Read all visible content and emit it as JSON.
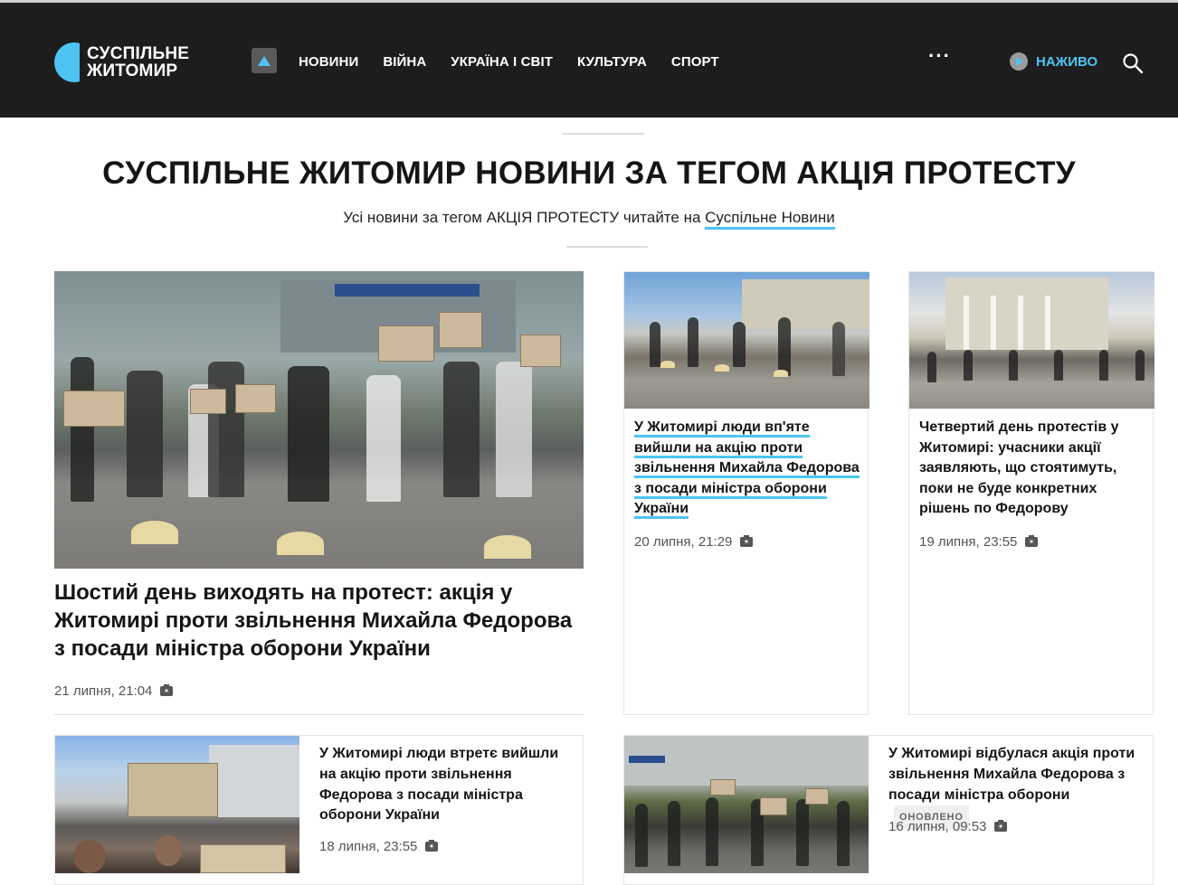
{
  "header": {
    "logo_line1": "СУСПІЛЬНЕ",
    "logo_line2": "ЖИТОМИР",
    "nav": [
      "НОВИНИ",
      "ВІЙНА",
      "УКРАЇНА І СВІТ",
      "КУЛЬТУРА",
      "СПОРТ"
    ],
    "more": "···",
    "live": "НАЖИВО",
    "accent_color": "#4dc4f4"
  },
  "page": {
    "title": "СУСПІЛЬНЕ ЖИТОМИР НОВИНИ ЗА ТЕГОМ АКЦІЯ ПРОТЕСТУ",
    "subtitle_prefix": "Усі новини за тегом АКЦІЯ ПРОТЕСТУ читайте на ",
    "subtitle_link": "Суспільне Новини"
  },
  "articles": [
    {
      "title": "Шостий день виходять на протест: акція у Житомирі проти звільнення Михайла Федорова з посади міністра оборони України",
      "date": "21 липня, 21:04"
    },
    {
      "title": "У Житомирі люди вп'яте вийшли на акцію проти звільнення Михайла Федорова з посади міністра оборони України",
      "date": "20 липня, 21:29"
    },
    {
      "title": "Четвертий день протестів у Житомирі: учасники акції заявляють, що стоятимуть, поки не буде конкретних рішень по Федорову",
      "date": "19 липня, 23:55"
    },
    {
      "title": "У Житомирі люди втретє вийшли на акцію проти звільнення Федорова з посади міністра оборони України",
      "date": "18 липня, 23:55"
    },
    {
      "title": "У Житомирі відбулася акція проти звільнення Михайла Федорова з посади міністра оборони",
      "badge": "ОНОВЛЕНО",
      "date": "16 липня, 09:53"
    }
  ]
}
